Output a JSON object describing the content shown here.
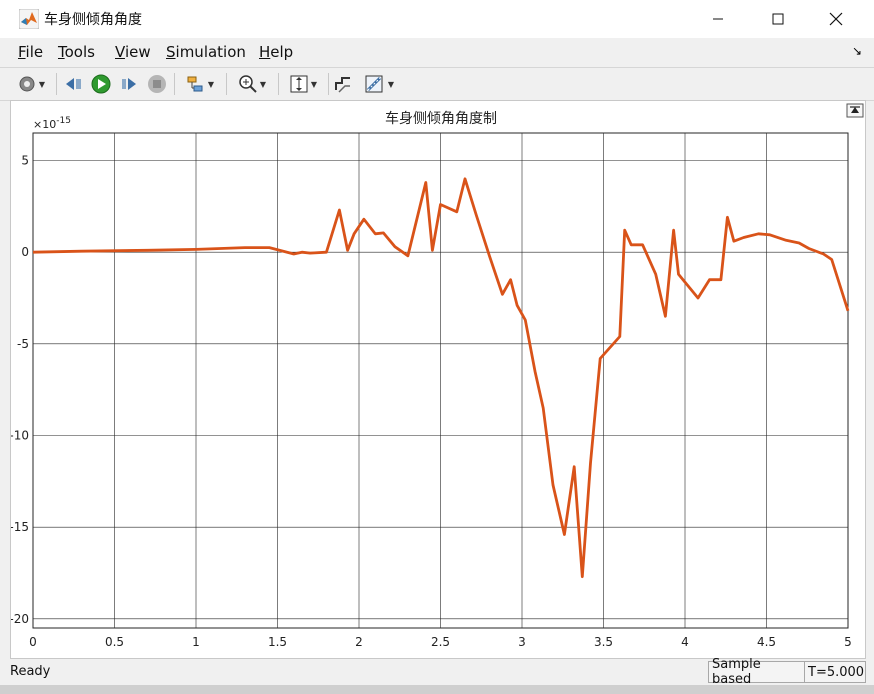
{
  "window": {
    "title": "车身侧倾角角度"
  },
  "menu": {
    "items": [
      {
        "label": "File"
      },
      {
        "label": "Tools"
      },
      {
        "label": "View"
      },
      {
        "label": "Simulation"
      },
      {
        "label": "Help"
      }
    ]
  },
  "toolbar": {
    "icons": [
      "settings-icon",
      "step-back-icon",
      "run-icon",
      "step-forward-icon",
      "stop-icon",
      "signal-select-icon",
      "zoom-in-icon",
      "autoscale-icon",
      "legend-icon",
      "style-icon"
    ]
  },
  "status": {
    "ready": "Ready",
    "sample_mode": "Sample based",
    "time": "T=5.000"
  },
  "colors": {
    "line": "#d95319",
    "grid": "#262626"
  },
  "chart_data": {
    "type": "line",
    "title": "车身侧倾角角度制",
    "exponent_label": "×10",
    "exponent_power": "-15",
    "xlim": [
      0,
      5
    ],
    "ylim": [
      -20.5,
      6.5
    ],
    "x_ticks": [
      0,
      0.5,
      1,
      1.5,
      2,
      2.5,
      3,
      3.5,
      4,
      4.5,
      5
    ],
    "x_tick_labels": [
      "0",
      "0.5",
      "1",
      "1.5",
      "2",
      "2.5",
      "3",
      "3.5",
      "4",
      "4.5",
      "5"
    ],
    "y_ticks": [
      5,
      0,
      -5,
      -10,
      -15,
      -20
    ],
    "y_tick_labels": [
      "5",
      "0",
      "-5",
      "-10",
      "-15",
      "-20"
    ],
    "grid": true,
    "series": [
      {
        "x": [
          0,
          0.3,
          0.7,
          1.0,
          1.3,
          1.45,
          1.6,
          1.65,
          1.7,
          1.8,
          1.88,
          1.93,
          1.97,
          2.03,
          2.1,
          2.15,
          2.22,
          2.3,
          2.41,
          2.45,
          2.5,
          2.6,
          2.65,
          2.72,
          2.8,
          2.88,
          2.93,
          2.97,
          3.02,
          3.08,
          3.13,
          3.19,
          3.26,
          3.32,
          3.37,
          3.42,
          3.48,
          3.6,
          3.63,
          3.67,
          3.74,
          3.82,
          3.88,
          3.93,
          3.96,
          4.08,
          4.15,
          4.22,
          4.26,
          4.3,
          4.36,
          4.45,
          4.52,
          4.62,
          4.7,
          4.76,
          4.85,
          4.9,
          5.0
        ],
        "y": [
          0,
          0.05,
          0.1,
          0.15,
          0.25,
          0.25,
          -0.1,
          0,
          -0.05,
          0,
          2.3,
          0.1,
          1.0,
          1.8,
          1.0,
          1.05,
          0.3,
          -0.2,
          3.8,
          0.1,
          2.6,
          2.2,
          4.0,
          2.0,
          -0.2,
          -2.3,
          -1.5,
          -2.9,
          -3.7,
          -6.5,
          -8.5,
          -12.7,
          -15.4,
          -11.7,
          -17.7,
          -11.5,
          -5.8,
          -4.6,
          1.2,
          0.4,
          0.4,
          -1.2,
          -3.5,
          1.2,
          -1.2,
          -2.5,
          -1.5,
          -1.5,
          1.9,
          0.6,
          0.8,
          1.0,
          0.95,
          0.65,
          0.5,
          0.2,
          -0.1,
          -0.4,
          -3.2
        ]
      }
    ]
  }
}
